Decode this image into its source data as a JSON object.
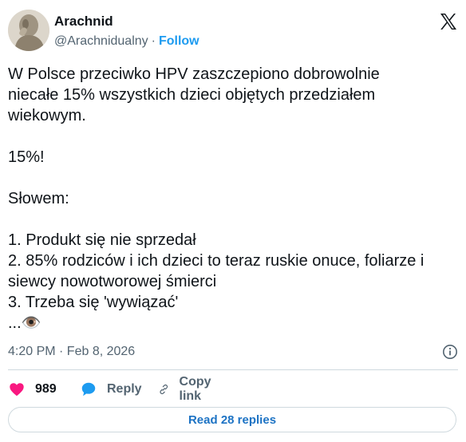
{
  "author": {
    "name": "Arachnid",
    "handle": "@Arachnidualny",
    "separator": "·",
    "follow_label": "Follow"
  },
  "tweet": {
    "text": "W Polsce przeciwko HPV zaszczepiono dobrowolnie\nniecałe 15% wszystkich dzieci objętych przedziałem\nwiekowym.\n\n15%!\n\nSłowem:\n\n1. Produkt się nie sprzedał\n2. 85% rodziców i ich dzieci to teraz ruskie onuce, foliarze i\nsiewcy nowotworowej śmierci\n3. Trzeba się 'wywiązać'\n...👁️",
    "timestamp": "4:20 PM · Feb 8, 2026"
  },
  "actions": {
    "like_count": "989",
    "reply_label": "Reply",
    "copy_label": "Copy link"
  },
  "footer": {
    "read_replies_label": "Read 28 replies"
  },
  "icons": {
    "brand": "x-logo-icon",
    "info": "info-icon",
    "like": "heart-icon",
    "reply": "speech-bubble-icon",
    "copy": "link-icon"
  },
  "colors": {
    "accent": "#1d9bf0",
    "like": "#f91880",
    "muted": "#536471",
    "text": "#0f1419",
    "border": "#cfd9de"
  }
}
